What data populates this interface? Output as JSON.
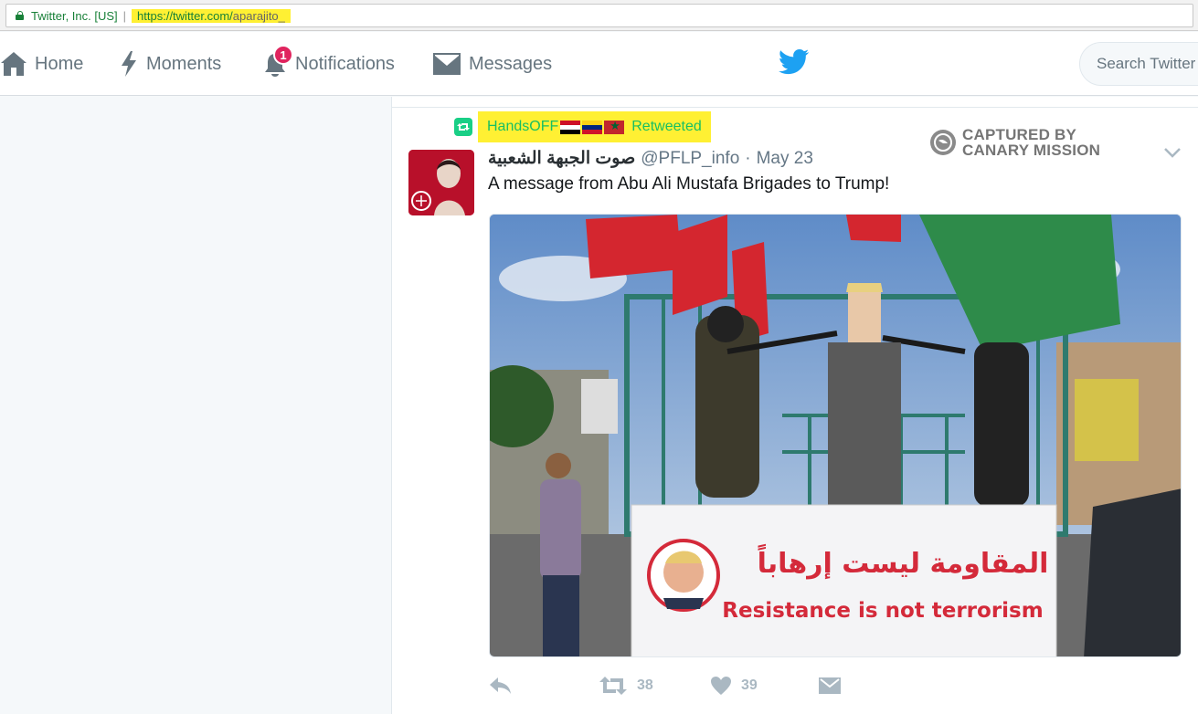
{
  "browser": {
    "security_label": "Twitter, Inc. [US]",
    "url_host": "https://twitter.com/",
    "url_path": "aparajito_"
  },
  "nav": {
    "home": "Home",
    "moments": "Moments",
    "notifications": "Notifications",
    "notifications_count": "1",
    "messages": "Messages",
    "search_placeholder": "Search Twitter"
  },
  "tweet": {
    "retweeter": "HandsOFF",
    "retweeted_label": "Retweeted",
    "watermark_line1": "CAPTURED BY",
    "watermark_line2": "CANARY MISSION",
    "author_name": "صوت الجبهة الشعبية",
    "author_handle": "@PFLP_info",
    "date": "May 23",
    "text": "A message from Abu Ali Mustafa Brigades to Trump!",
    "banner_arabic": "المقاومة ليست إرهاباً",
    "banner_english": "Resistance is not terrorism",
    "retweet_count": "38",
    "like_count": "39"
  },
  "colors": {
    "twitter_blue": "#1da1f2",
    "retweet_green": "#17bf63",
    "highlight_yellow": "#fff033",
    "notification_badge": "#e0245e"
  }
}
